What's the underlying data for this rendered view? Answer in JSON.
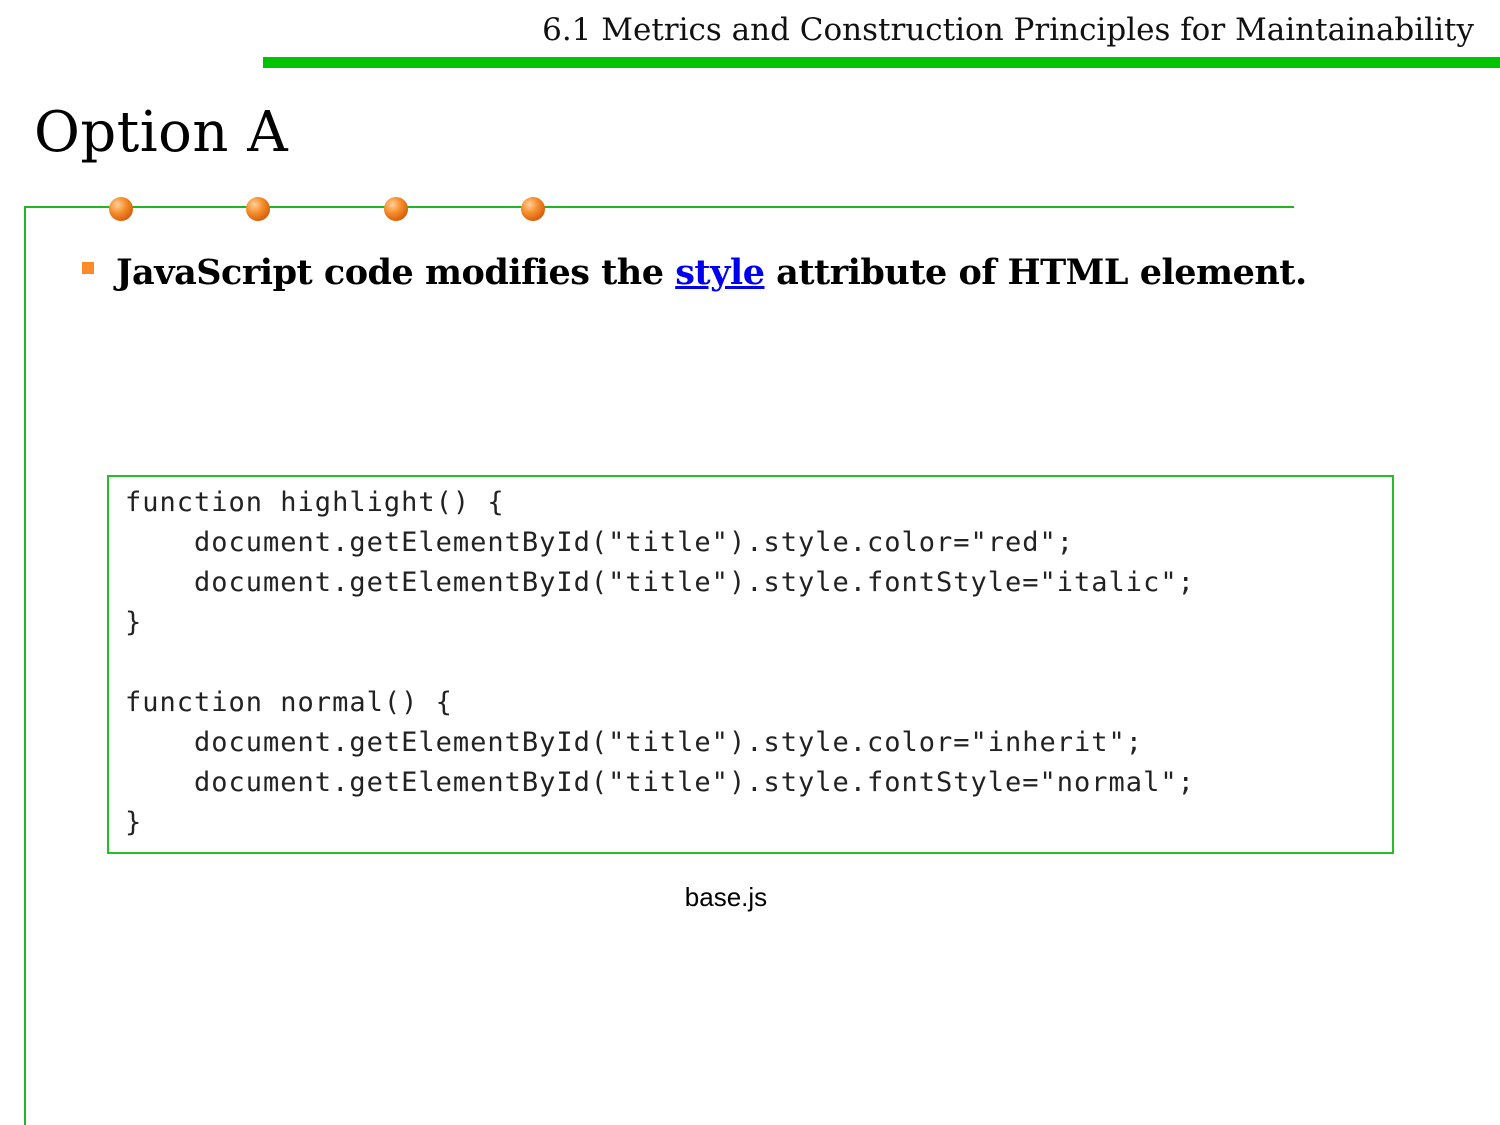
{
  "header": {
    "section_title": "6.1 Metrics and Construction Principles for Maintainability",
    "accent_color": "#00c400"
  },
  "slide": {
    "title": "Option A"
  },
  "bullet": {
    "text_before": "JavaScript code modifies the ",
    "link_text": "style",
    "text_after": " attribute of HTML element."
  },
  "code": {
    "lines": [
      "function highlight() {",
      "    document.getElementById(\"title\").style.color=\"red\";",
      "    document.getElementById(\"title\").style.fontStyle=\"italic\";",
      "}",
      "",
      "function normal() {",
      "    document.getElementById(\"title\").style.color=\"inherit\";",
      "    document.getElementById(\"title\").style.fontStyle=\"normal\";",
      "}"
    ]
  },
  "caption": "base.js"
}
